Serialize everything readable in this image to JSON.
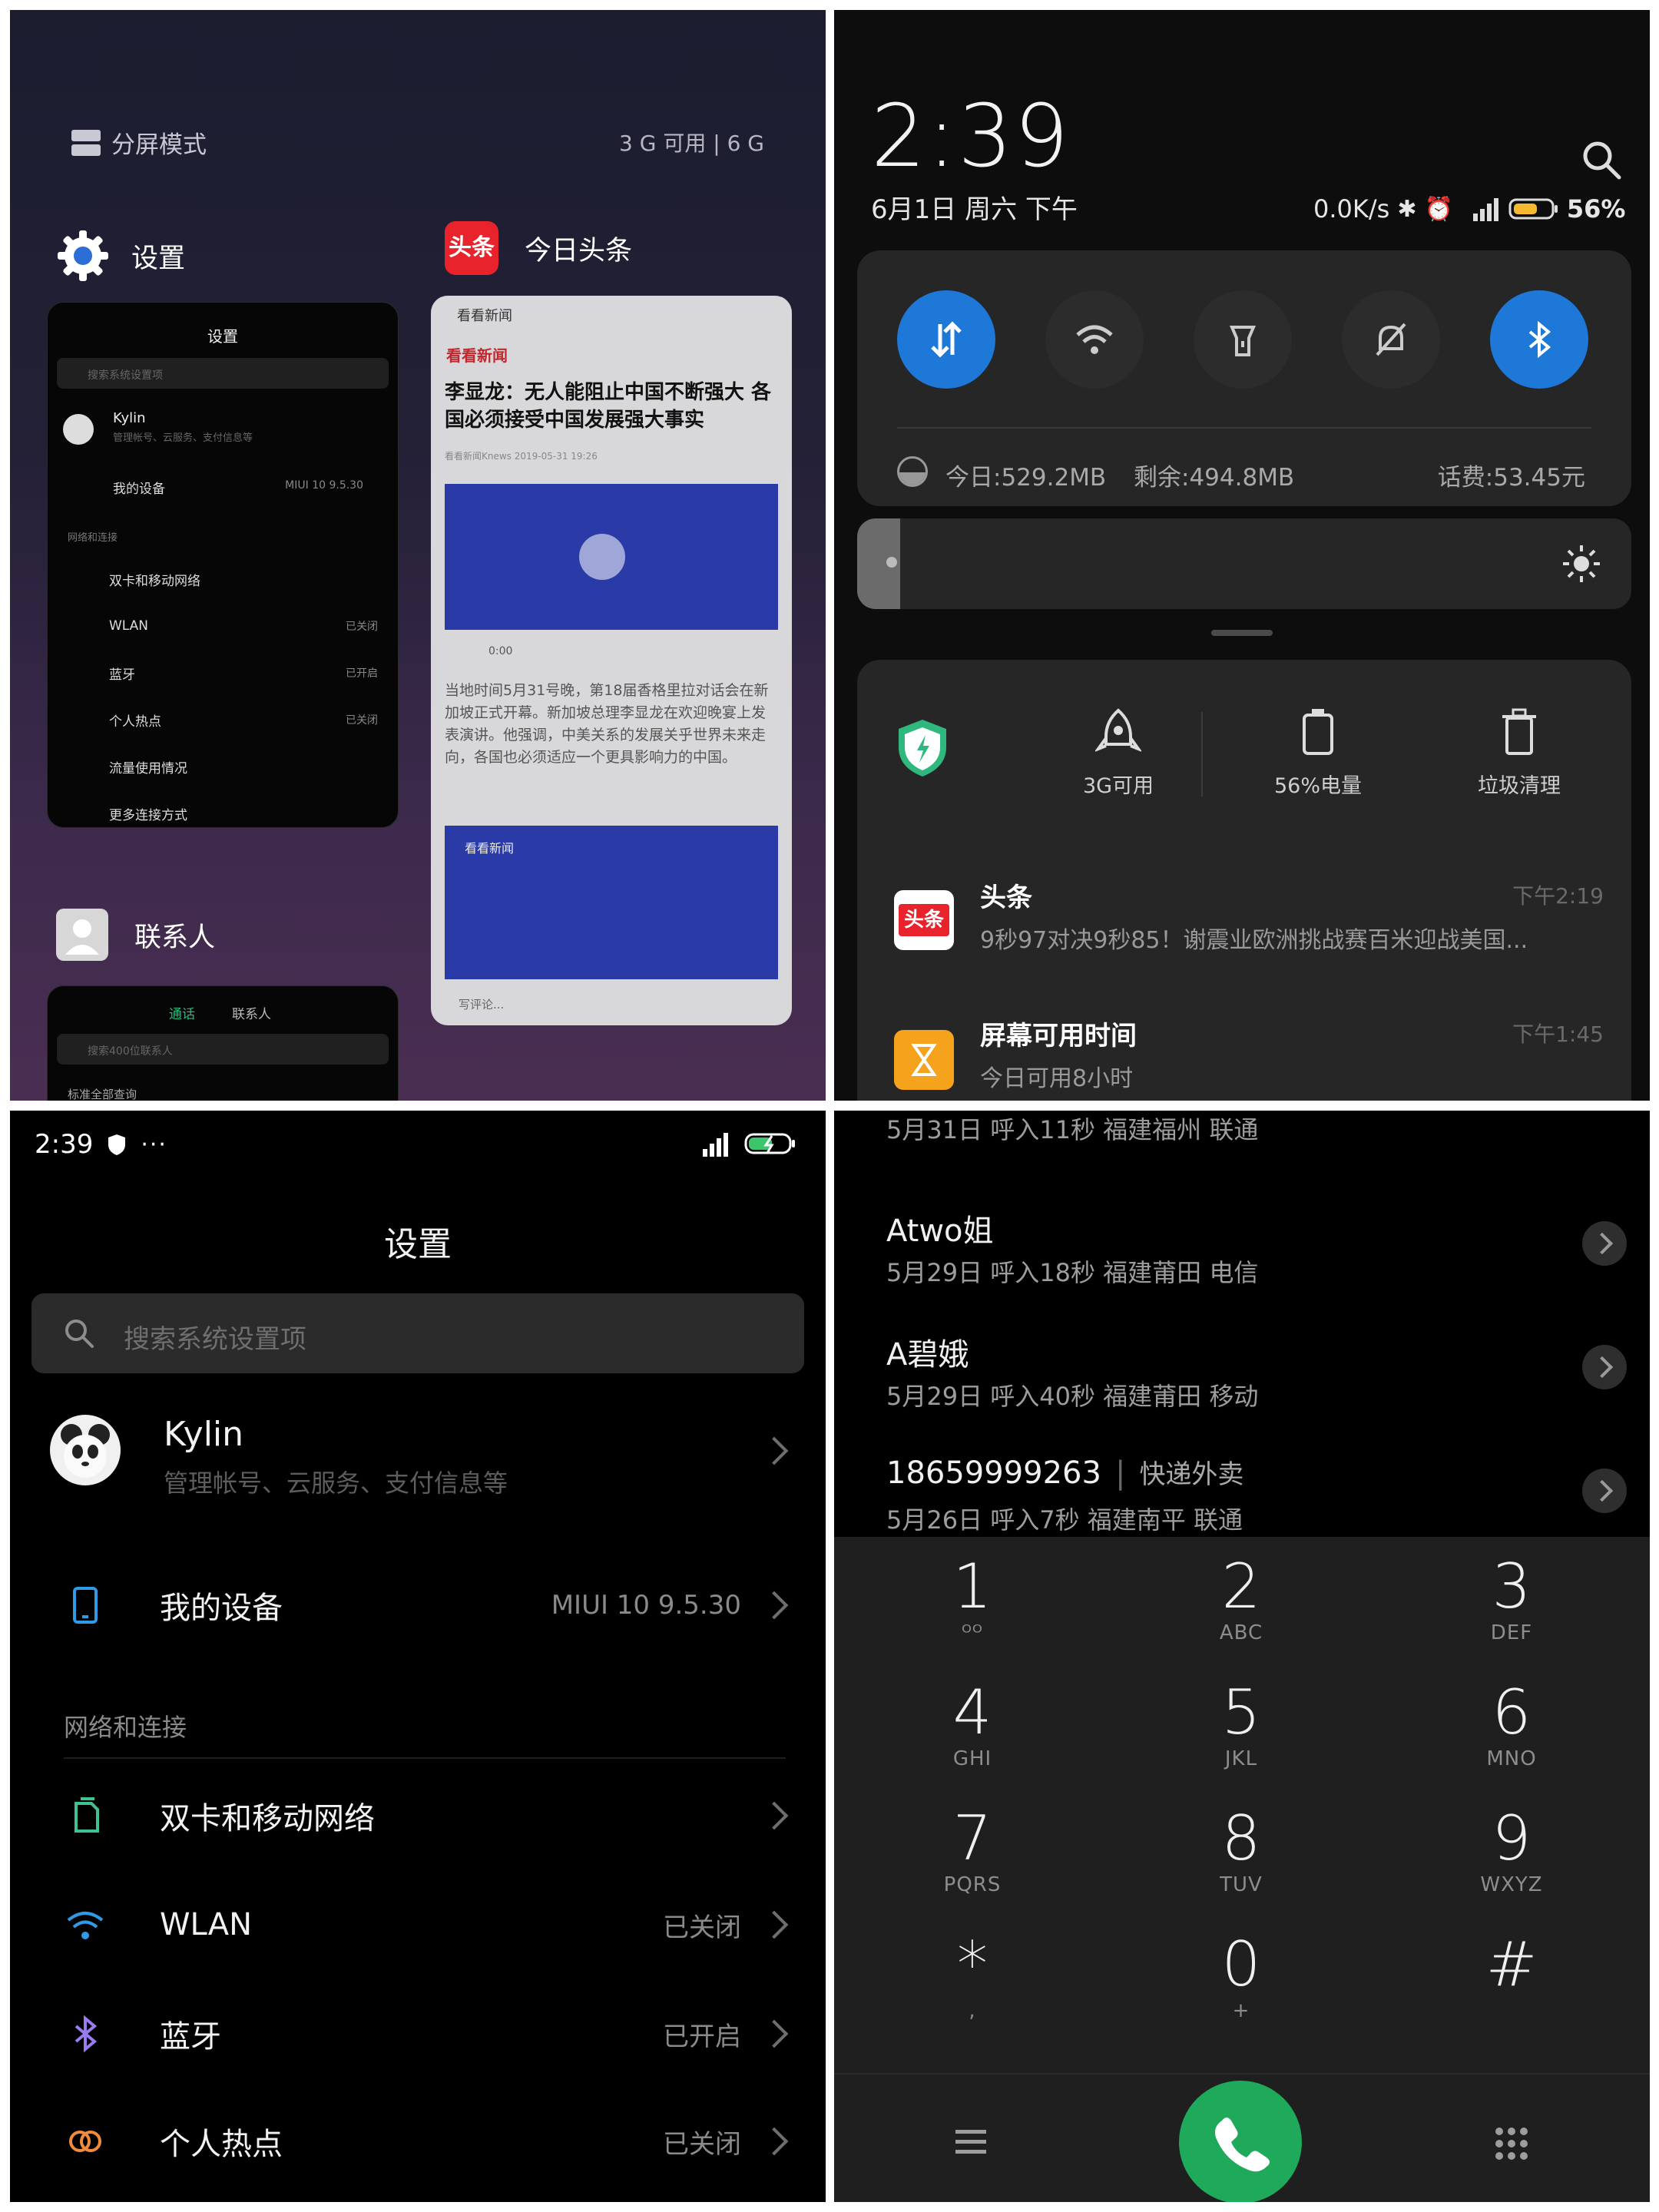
{
  "recents": {
    "split_screen_label": "分屏模式",
    "memory_label": "3 G 可用 | 6 G",
    "apps": [
      {
        "name": "设置"
      },
      {
        "name": "今日头条"
      },
      {
        "name": "联系人"
      }
    ],
    "settings_thumb": {
      "title": "设置",
      "search_placeholder": "搜索系统设置项",
      "account_name": "Kylin",
      "account_sub": "管理帐号、云服务、支付信息等",
      "device_label": "我的设备",
      "device_value": "MIUI 10 9.5.30",
      "section": "网络和连接",
      "rows": [
        {
          "label": "双卡和移动网络",
          "value": ""
        },
        {
          "label": "WLAN",
          "value": "已关闭"
        },
        {
          "label": "蓝牙",
          "value": "已开启"
        },
        {
          "label": "个人热点",
          "value": "已关闭"
        },
        {
          "label": "流量使用情况",
          "value": ""
        },
        {
          "label": "更多连接方式",
          "value": ""
        }
      ]
    },
    "news_thumb": {
      "source": "看看新闻",
      "brand": "看看新闻",
      "headline": "李显龙：无人能阻止中国不断强大 各国必须接受中国发展强大事实",
      "byline": "看看新闻Knews  2019-05-31 19:26",
      "audio_time": "0:00",
      "body": "当地时间5月31号晚，第18届香格里拉对话会在新加坡正式开幕。新加坡总理李显龙在欢迎晚宴上发表演讲。他强调，中美关系的发展关乎世界未来走向，各国也必须适应一个更具影响力的中国。",
      "brand2": "看看新闻",
      "comment_placeholder": "写评论..."
    },
    "contacts_thumb": {
      "tab_calls": "通话",
      "tab_contacts": "联系人",
      "search_placeholder": "搜索400位联系人",
      "row": "标准全部查询"
    }
  },
  "notification_shade": {
    "time": "2:39",
    "date": "6月1日 周六 下午",
    "net_speed": "0.0K/s",
    "battery": "56%",
    "data_today": "今日:529.2MB",
    "data_left": "剩余:494.8MB",
    "balance": "话费:53.45元",
    "tools": [
      {
        "label": "3G可用",
        "icon": "rocket-icon"
      },
      {
        "label": "56%电量",
        "icon": "battery-icon"
      },
      {
        "label": "垃圾清理",
        "icon": "trash-icon"
      }
    ],
    "notifications": [
      {
        "app": "头条",
        "time": "下午2:19",
        "text": "9秒97对决9秒85！谢震业欧洲挑战赛百米迎战美国..."
      },
      {
        "app": "屏幕可用时间",
        "time": "下午1:45",
        "text": "今日可用8小时"
      }
    ],
    "colors": {
      "accent": "#1e78d8",
      "toutiao": "#e8232b",
      "screen_time": "#f5a21c",
      "shield": "#2fb77d"
    }
  },
  "settings": {
    "status_time": "2:39",
    "title": "设置",
    "search_placeholder": "搜索系统设置项",
    "account_name": "Kylin",
    "account_sub": "管理帐号、云服务、支付信息等",
    "device_label": "我的设备",
    "device_value": "MIUI 10 9.5.30",
    "section_label": "网络和连接",
    "rows": [
      {
        "label": "双卡和移动网络",
        "value": "",
        "icon": "sim-icon"
      },
      {
        "label": "WLAN",
        "value": "已关闭",
        "icon": "wifi-icon"
      },
      {
        "label": "蓝牙",
        "value": "已开启",
        "icon": "bluetooth-icon"
      },
      {
        "label": "个人热点",
        "value": "已关闭",
        "icon": "hotspot-icon"
      }
    ]
  },
  "dialer": {
    "calls": [
      {
        "name": "",
        "detail": "5月31日 呼入11秒  福建福州 联通"
      },
      {
        "name": "Atwo姐",
        "detail": "5月29日 呼入18秒  福建莆田 电信"
      },
      {
        "name": "A碧娥",
        "detail": "5月29日 呼入40秒  福建莆田 移动"
      },
      {
        "name": "18659999263",
        "tag": "快递外卖",
        "detail": "5月26日 呼入7秒  福建南平 联通"
      }
    ],
    "keys": [
      {
        "digit": "1",
        "letters": "ᴼᴼ"
      },
      {
        "digit": "2",
        "letters": "ABC"
      },
      {
        "digit": "3",
        "letters": "DEF"
      },
      {
        "digit": "4",
        "letters": "GHI"
      },
      {
        "digit": "5",
        "letters": "JKL"
      },
      {
        "digit": "6",
        "letters": "MNO"
      },
      {
        "digit": "7",
        "letters": "PQRS"
      },
      {
        "digit": "8",
        "letters": "TUV"
      },
      {
        "digit": "9",
        "letters": "WXYZ"
      },
      {
        "digit": "*",
        "letters": ","
      },
      {
        "digit": "0",
        "letters": "+"
      },
      {
        "digit": "#",
        "letters": ""
      }
    ],
    "call_button_color": "#1fa95b"
  }
}
